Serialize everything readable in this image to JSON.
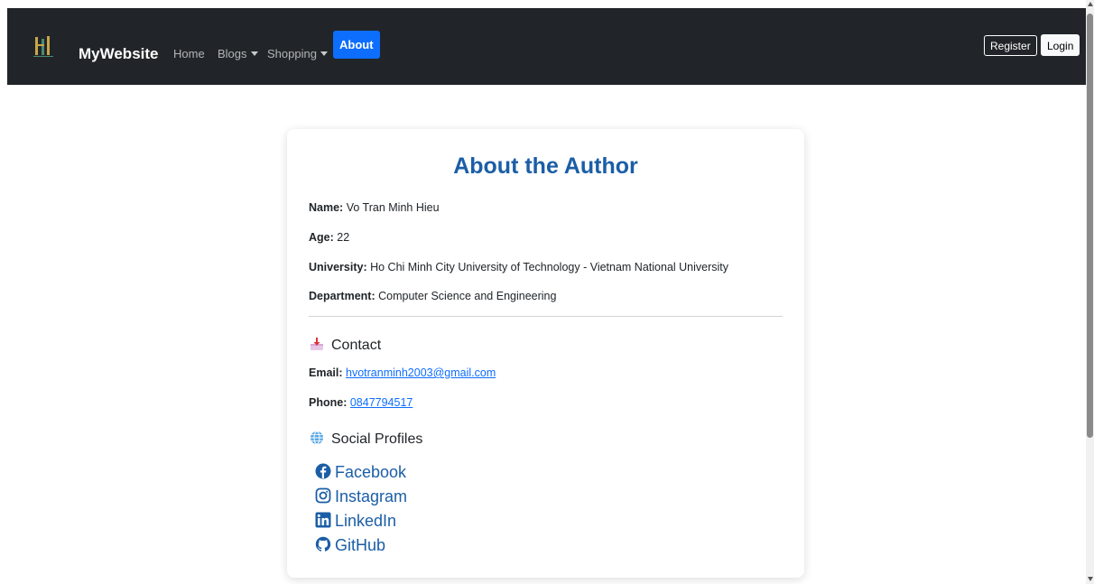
{
  "navbar": {
    "brand": "MyWebsite",
    "links": [
      "Home",
      "Blogs",
      "Shopping"
    ],
    "active": "About",
    "register": "Register",
    "login": "Login"
  },
  "card": {
    "title": "About the Author",
    "name_label": "Name:",
    "name_value": "Vo Tran Minh Hieu",
    "age_label": "Age:",
    "age_value": "22",
    "university_label": "University:",
    "university_value": "Ho Chi Minh City University of Technology - Vietnam National University",
    "department_label": "Department:",
    "department_value": "Computer Science and Engineering",
    "contact_heading": "Contact",
    "email_label": "Email:",
    "email_value": "hvotranminh2003@gmail.com",
    "phone_label": "Phone:",
    "phone_value": "0847794517",
    "social_heading": "Social Profiles",
    "social": [
      "Facebook",
      "Instagram",
      "LinkedIn",
      "GitHub"
    ]
  },
  "icons": {
    "contact": "inbox-tray-icon",
    "social": "globe-icon",
    "facebook": "facebook-icon",
    "instagram": "instagram-icon",
    "linkedin": "linkedin-icon",
    "github": "github-icon"
  },
  "colors": {
    "navbar_bg": "#212529",
    "accent": "#0d6efd",
    "title": "#1b5ea6"
  }
}
